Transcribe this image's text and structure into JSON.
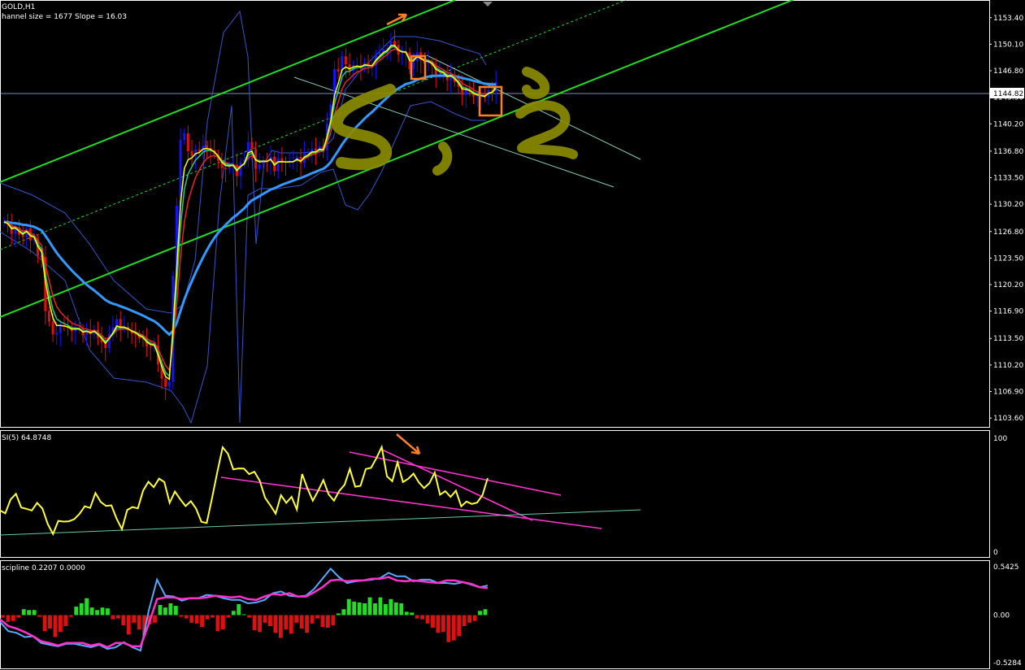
{
  "chart_data": [
    {
      "type": "candlestick",
      "title": "GOLD,H1",
      "subtitle": "hannel size = 1677 Slope = 16.03",
      "ylim": [
        1102.5,
        1155.5
      ],
      "ytick_labels": [
        "1153.40",
        "1150.10",
        "1146.80",
        "1143.50",
        "1140.20",
        "1136.80",
        "1133.50",
        "1130.20",
        "1126.80",
        "1123.50",
        "1120.20",
        "1116.90",
        "1113.50",
        "1110.20",
        "1106.90",
        "1103.60"
      ],
      "current_price": "1144.82",
      "colors": {
        "up": "#1414ff",
        "down": "#e01010",
        "channel": "#22dd22",
        "ma_slow": "#3399ff",
        "ma_fast": "#ffff00",
        "ma_mid": "#22cc88",
        "ma_red": "#ee2222",
        "bands": "#3355cc",
        "trend": "#88ccbb"
      },
      "series_close": [
        1128.0,
        1127.6,
        1126.5,
        1127.3,
        1126.4,
        1126.1,
        1127.2,
        1125.7,
        1125.9,
        1123.8,
        1123.6,
        1116.9,
        1115.6,
        1114.0,
        1114.2,
        1115.1,
        1115.0,
        1114.8,
        1114.4,
        1114.7,
        1114.7,
        1113.9,
        1114.5,
        1114.0,
        1114.6,
        1113.6,
        1113.0,
        1112.3,
        1114.1,
        1114.9,
        1115.9,
        1114.8,
        1114.9,
        1114.5,
        1114.1,
        1114.0,
        1113.5,
        1113.4,
        1112.5,
        1112.4,
        1112.6,
        1110.3,
        1108.5,
        1107.5,
        1108.1,
        1121.3,
        1130.0,
        1138.2,
        1139.0,
        1136.8,
        1136.2,
        1137.0,
        1136.8,
        1137.5,
        1137.2,
        1136.9,
        1136.4,
        1135.6,
        1134.7,
        1134.6,
        1134.9,
        1135.1,
        1133.7,
        1135.4,
        1135.7,
        1137.9,
        1137.0,
        1134.6,
        1135.2,
        1135.6,
        1135.5,
        1136.1,
        1134.3,
        1135.9,
        1135.5,
        1135.4,
        1135.5,
        1135.5,
        1136.1,
        1135.3,
        1136.6,
        1136.6,
        1137.1,
        1136.7,
        1137.4,
        1136.9,
        1140.2,
        1142.6,
        1147.0,
        1146.7,
        1148.6,
        1147.6,
        1146.8,
        1147.5,
        1147.5,
        1147.2,
        1147.8,
        1147.4,
        1147.4,
        1148.8,
        1149.1,
        1149.5,
        1149.6,
        1150.5,
        1150.0,
        1148.8,
        1148.9,
        1149.1,
        1147.0,
        1148.0,
        1149.1,
        1148.1,
        1147.7,
        1147.9,
        1147.4,
        1146.3,
        1146.4,
        1146.4,
        1145.6,
        1146.3,
        1145.4,
        1144.8,
        1143.8,
        1144.4,
        1144.2,
        1143.6,
        1143.6,
        1143.6,
        1143.5,
        1144.4,
        1144.3,
        1145.4
      ],
      "rsi_panel": {
        "title": "SI(5) 64.8748",
        "ylim": [
          0,
          100
        ],
        "ytick_labels": [
          "100",
          "0"
        ],
        "values": [
          36.6,
          34.1,
          46.2,
          51.2,
          39.2,
          38.0,
          36.6,
          43.3,
          38.3,
          24.8,
          15.9,
          27.4,
          26.8,
          27.1,
          28.9,
          33.6,
          40.2,
          38.8,
          51.9,
          44.1,
          40.6,
          41.1,
          29.3,
          20.1,
          37.0,
          39.6,
          38.4,
          54.1,
          61.8,
          57.0,
          64.5,
          61.5,
          43.3,
          53.2,
          46.4,
          40.4,
          44.7,
          38.1,
          26.6,
          25.6,
          47.6,
          70.5,
          92.1,
          86.4,
          72.7,
          73.5,
          73.4,
          68.5,
          70.6,
          62.6,
          47.7,
          41.1,
          33.8,
          50.0,
          43.2,
          48.6,
          37.4,
          68.6,
          55.9,
          45.2,
          53.7,
          63.3,
          50.7,
          45.2,
          53.8,
          59.1,
          73.1,
          57.4,
          58.2,
          73.0,
          74.0,
          82.4,
          92.3,
          66.5,
          62.3,
          78.9,
          61.6,
          64.4,
          68.9,
          61.3,
          56.2,
          60.5,
          69.8,
          50.4,
          53.6,
          48.5,
          53.9,
          40.2,
          44.4,
          42.3,
          43.5,
          50.0,
          65.0
        ],
        "colors": {
          "line": "#ffff33",
          "trend": "#ff33cc",
          "support": "#66ccaa"
        }
      },
      "osc_panel": {
        "title": "scipline 0.2207 0.0000",
        "ylim": [
          -0.64,
          0.64
        ],
        "ytick_labels": [
          "0.5425",
          "0.00",
          "-0.5284"
        ],
        "histogram": [
          -0.03,
          -0.08,
          -0.07,
          -0.03,
          0.07,
          0.06,
          0.06,
          -0.02,
          -0.19,
          -0.16,
          -0.26,
          -0.2,
          -0.13,
          -0.02,
          0.1,
          0.14,
          0.2,
          0.09,
          0.06,
          0.09,
          0.08,
          -0.05,
          -0.04,
          -0.12,
          -0.23,
          -0.09,
          -0.17,
          -0.24,
          -0.11,
          -0.09,
          0.12,
          0.09,
          0.14,
          0.11,
          -0.02,
          -0.04,
          -0.09,
          -0.1,
          -0.14,
          -0.05,
          -0.03,
          -0.19,
          -0.17,
          -0.03,
          0.05,
          0.13,
          0.01,
          -0.03,
          -0.18,
          -0.2,
          -0.09,
          -0.13,
          -0.21,
          -0.27,
          -0.17,
          -0.22,
          -0.09,
          -0.16,
          -0.21,
          -0.1,
          -0.04,
          -0.14,
          -0.15,
          -0.12,
          0.02,
          0.07,
          0.19,
          0.16,
          0.15,
          0.14,
          0.21,
          0.14,
          0.21,
          0.13,
          0.19,
          0.15,
          0.14,
          0.04,
          0.03,
          -0.04,
          -0.05,
          -0.1,
          -0.15,
          -0.21,
          -0.2,
          -0.32,
          -0.3,
          -0.25,
          -0.13,
          -0.09,
          -0.07,
          0.05,
          0.07
        ],
        "line_magenta": [
          -0.05,
          -0.13,
          -0.16,
          -0.2,
          -0.25,
          -0.31,
          -0.33,
          -0.36,
          -0.33,
          -0.33,
          -0.33,
          -0.36,
          -0.34,
          -0.38,
          -0.33,
          -0.33,
          -0.37,
          -0.37,
          -0.1,
          0.19,
          0.21,
          0.21,
          0.19,
          0.2,
          0.2,
          0.21,
          0.23,
          0.22,
          0.21,
          0.22,
          0.19,
          0.18,
          0.22,
          0.25,
          0.24,
          0.26,
          0.22,
          0.22,
          0.27,
          0.33,
          0.41,
          0.42,
          0.4,
          0.41,
          0.41,
          0.43,
          0.43,
          0.45,
          0.41,
          0.4,
          0.41,
          0.4,
          0.39,
          0.38,
          0.41,
          0.41,
          0.39,
          0.37,
          0.33,
          0.32
        ],
        "line_blue": [
          -0.08,
          -0.19,
          -0.21,
          -0.26,
          -0.25,
          -0.33,
          -0.35,
          -0.37,
          -0.34,
          -0.34,
          -0.36,
          -0.38,
          -0.35,
          -0.4,
          -0.38,
          -0.32,
          -0.38,
          -0.42,
          0.06,
          0.42,
          0.23,
          0.22,
          0.17,
          0.2,
          0.2,
          0.24,
          0.23,
          0.2,
          0.18,
          0.18,
          0.14,
          0.15,
          0.18,
          0.26,
          0.28,
          0.23,
          0.22,
          0.23,
          0.31,
          0.43,
          0.55,
          0.45,
          0.38,
          0.4,
          0.41,
          0.42,
          0.44,
          0.5,
          0.46,
          0.46,
          0.4,
          0.42,
          0.42,
          0.38,
          0.38,
          0.37,
          0.39,
          0.36,
          0.33,
          0.35
        ],
        "colors": {
          "pos": "#22dd22",
          "neg": "#dd1111",
          "magenta": "#ff33cc",
          "blue": "#55aaff"
        }
      }
    }
  ],
  "annotations": {
    "handwriting_color": "#8a8a00",
    "box_color": "#ff7f27",
    "arrow_color": "#ff7f27"
  }
}
